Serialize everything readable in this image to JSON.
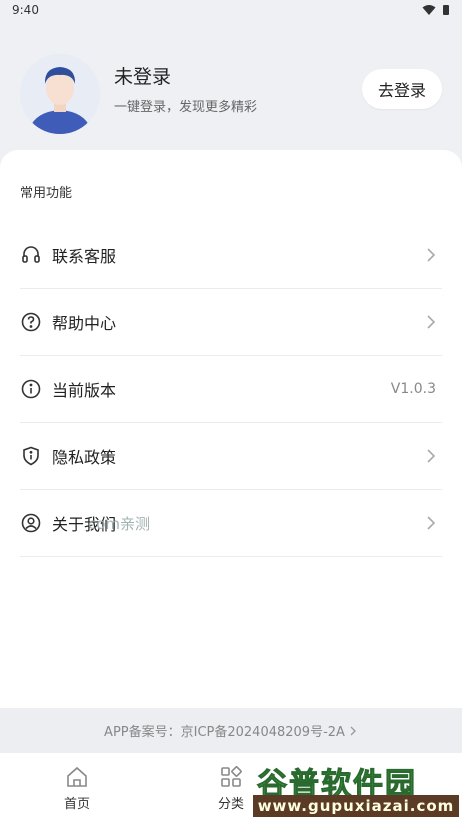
{
  "status": {
    "time": "9:40"
  },
  "profile": {
    "name": "未登录",
    "desc": "一键登录，发现更多精彩",
    "login_label": "去登录"
  },
  "section": {
    "title": "常用功能"
  },
  "menu": {
    "items": [
      {
        "label": "联系客服",
        "icon": "headset-icon",
        "right": ""
      },
      {
        "label": "帮助中心",
        "icon": "help-circle-icon",
        "right": ""
      },
      {
        "label": "当前版本",
        "icon": "info-icon",
        "right": "V1.0.3"
      },
      {
        "label": "隐私政策",
        "icon": "shield-info-icon",
        "right": ""
      },
      {
        "label": "关于我们",
        "icon": "user-circle-icon",
        "right": ""
      }
    ]
  },
  "watermark": "com亲测",
  "footer": {
    "icp": "APP备案号：京ICP备2024048209号-2A"
  },
  "tabs": [
    {
      "label": "首页",
      "icon": "home-icon"
    },
    {
      "label": "分类",
      "icon": "grid-icon"
    }
  ],
  "brand": {
    "name": "谷普软件园",
    "url": "www.gupuxiazai.com"
  },
  "colors": {
    "page_bg": "#eef0f4",
    "brand_green": "#3fb54a",
    "brand_brown": "#5b3b26"
  }
}
